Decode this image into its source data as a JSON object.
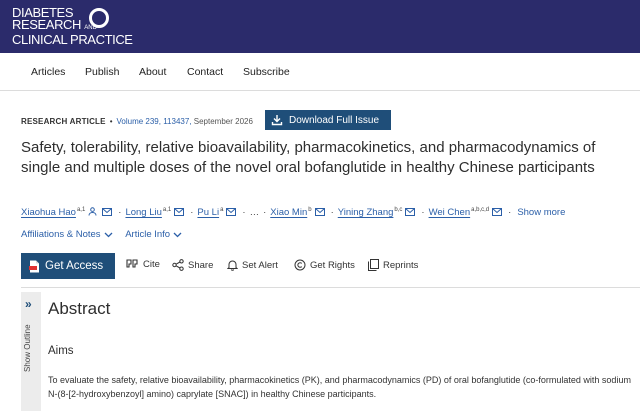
{
  "journal": {
    "logo_line1": "DIABETES",
    "logo_line2": "RESEARCH",
    "logo_line2_and": "AND",
    "logo_line3": "CLINICAL PRACTICE"
  },
  "nav": {
    "items": [
      "Articles",
      "Publish",
      "About",
      "Contact",
      "Subscribe"
    ]
  },
  "meta": {
    "article_type": "RESEARCH ARTICLE",
    "volume": "Volume 239, 113437,",
    "date": "September 2026",
    "download_label": "Download Full Issue"
  },
  "title": "Safety, tolerability, relative bioavailability, pharmacokinetics, and pharmacodynamics of single and multiple doses of the novel oral bofanglutide in healthy Chinese participants",
  "authors": [
    {
      "name": "Xiaohua Hao",
      "sup": "a,1"
    },
    {
      "name": "Long Liu",
      "sup": "a,1"
    },
    {
      "name": "Pu Li",
      "sup": "a"
    },
    {
      "name": "Xiao Min",
      "sup": "b"
    },
    {
      "name": "Yining Zhang",
      "sup": "b,c"
    },
    {
      "name": "Wei Chen",
      "sup": "a,b,c,d"
    }
  ],
  "authors_ellipsis": "…",
  "show_more": "Show more",
  "links": {
    "affiliations": "Affiliations & Notes",
    "article_info": "Article Info"
  },
  "actions": {
    "get_access": "Get Access",
    "cite": "Cite",
    "share": "Share",
    "set_alert": "Set Alert",
    "get_rights": "Get Rights",
    "reprints": "Reprints"
  },
  "outline": {
    "label": "Show Outline",
    "arrows": "»"
  },
  "abstract": {
    "heading": "Abstract",
    "aims_heading": "Aims",
    "text": "To evaluate the safety, relative bioavailability, pharmacokinetics (PK), and pharmacodynamics (PD) of oral bofanglutide (co-formulated with sodium N-(8-[2-hydroxybenzoyl] amino) caprylate [SNAC]) in healthy Chinese participants."
  },
  "colors": {
    "header_bg": "#2b2b6b",
    "primary_button": "#1f4e79",
    "link": "#2b5fa8"
  }
}
